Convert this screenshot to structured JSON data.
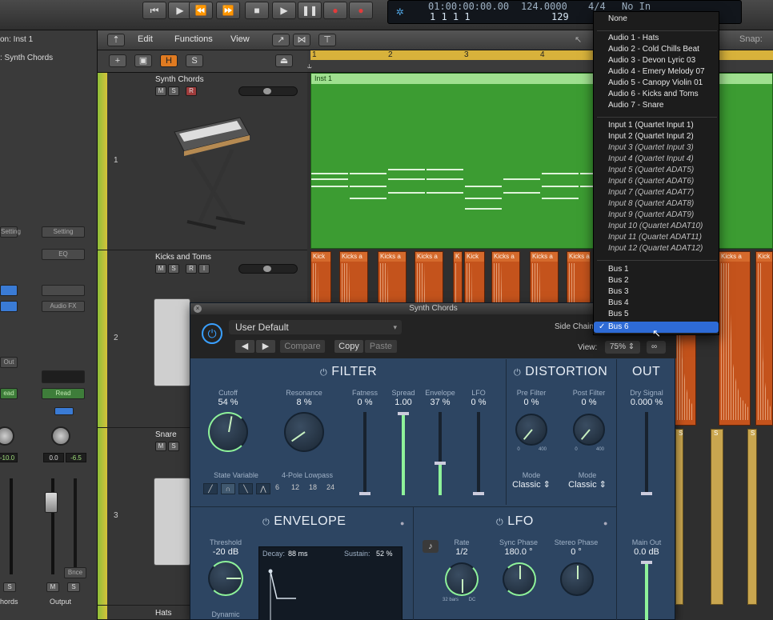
{
  "transport": {
    "buttons": [
      "⏮",
      "▶",
      "⏪",
      "⏩",
      "■",
      "▶",
      "❚❚",
      "●",
      "●"
    ],
    "lcd_time": "01:00:00:00.00",
    "lcd_bars": "1  1  1    1",
    "tempo": "124.0000",
    "tempo_sub": "129",
    "signature": "4/4",
    "no_in": "No In"
  },
  "inspector": {
    "region_label": "on: Inst 1",
    "track_label": ":  Synth Chords",
    "setting_label": "Setting",
    "eq_label": "EQ",
    "audio_fx": "Audio FX",
    "out_label": "Out",
    "read_a": "ead",
    "read_b": "Read",
    "level_a": "-10.0",
    "level_b": "0.0",
    "level_c": "-6.5",
    "bnce": "Bnce",
    "m_label": "M",
    "s_label": "S",
    "name_a": "hords",
    "name_b": "Output"
  },
  "menubar": {
    "edit": "Edit",
    "functions": "Functions",
    "view": "View",
    "snap": "Snap:"
  },
  "ruler": {
    "marks": [
      "1",
      "2",
      "3",
      "4"
    ]
  },
  "tracks": [
    {
      "num": "1",
      "name": "Synth Chords"
    },
    {
      "num": "2",
      "name": "Kicks and Toms"
    },
    {
      "num": "3",
      "name": "Snare"
    },
    {
      "num": "",
      "name": "Hats"
    }
  ],
  "track_buttons": {
    "m": "M",
    "s": "S",
    "r": "R",
    "i": "I"
  },
  "region": {
    "label": "Inst 1",
    "audio_label": "Kick",
    "audio_label_long": "Kicks a",
    "audio_label_k": "K",
    "snare_label": "S"
  },
  "plugin": {
    "title": "Synth Chords",
    "preset": "User Default",
    "compare": "Compare",
    "copy": "Copy",
    "paste": "Paste",
    "sidechain": "Side Chain",
    "view_label": "View:",
    "view_value": "75%",
    "filter": {
      "title": "FILTER",
      "cutoff": {
        "label": "Cutoff",
        "value": "54 %"
      },
      "resonance": {
        "label": "Resonance",
        "value": "8 %"
      },
      "fatness": {
        "label": "Fatness",
        "value": "0 %"
      },
      "spread": {
        "label": "Spread",
        "value": "1.00"
      },
      "envelope": {
        "label": "Envelope",
        "value": "37 %"
      },
      "lfo": {
        "label": "LFO",
        "value": "0 %"
      },
      "state_variable": "State Variable",
      "four_pole": "4-Pole Lowpass",
      "slopes": [
        "6",
        "12",
        "18",
        "24"
      ]
    },
    "distortion": {
      "title": "DISTORTION",
      "pre_filter": {
        "label": "Pre Filter",
        "value": "0 %"
      },
      "post_filter": {
        "label": "Post Filter",
        "value": "0 %"
      },
      "mode_label": "Mode",
      "mode_a": "Classic",
      "mode_b": "Classic",
      "range_lo": "0",
      "range_hi": "400"
    },
    "out": {
      "title": "OUT",
      "dry": {
        "label": "Dry Signal",
        "value": "0.000 %"
      },
      "main": {
        "label": "Main Out",
        "value": "0.0 dB"
      }
    },
    "envelope": {
      "title": "ENVELOPE",
      "threshold": {
        "label": "Threshold",
        "value": "-20 dB"
      },
      "dynamic": "Dynamic",
      "decay_label": "Decay:",
      "decay_value": "88 ms",
      "sustain_label": "Sustain:",
      "sustain_value": "52 %"
    },
    "lfo": {
      "title": "LFO",
      "rate": {
        "label": "Rate",
        "value": "1/2"
      },
      "sync_phase": {
        "label": "Sync Phase",
        "value": "180.0 °"
      },
      "stereo_phase": {
        "label": "Stereo Phase",
        "value": "0 °"
      },
      "range_lo": "32 bars",
      "range_hi": "DC"
    }
  },
  "dropdown": {
    "none": "None",
    "audio": [
      "Audio 1 - Hats",
      "Audio 2 - Cold Chills Beat",
      "Audio 3 - Devon Lyric 03",
      "Audio 4 - Emery Melody 07",
      "Audio 5 - Canopy Violin 01",
      "Audio 6 - Kicks and Toms",
      "Audio 7 - Snare"
    ],
    "inputs": [
      "Input 1  (Quartet Input 1)",
      "Input 2  (Quartet Input 2)",
      "Input 3  (Quartet Input 3)",
      "Input 4  (Quartet Input 4)",
      "Input 5  (Quartet ADAT5)",
      "Input 6  (Quartet ADAT6)",
      "Input 7  (Quartet ADAT7)",
      "Input 8  (Quartet ADAT8)",
      "Input 9  (Quartet ADAT9)",
      "Input 10  (Quartet ADAT10)",
      "Input 11  (Quartet ADAT11)",
      "Input 12  (Quartet ADAT12)"
    ],
    "buses": [
      "Bus 1",
      "Bus 2",
      "Bus 3",
      "Bus 4",
      "Bus 5",
      "Bus 6"
    ],
    "selected_bus": "Bus 6"
  },
  "colors": {
    "accent_blue": "#2e6bd6",
    "region_green": "#3c9c32",
    "audio_orange": "#c4531c",
    "plugin_blue": "#2d4562",
    "knob_green": "#8ef29a"
  }
}
